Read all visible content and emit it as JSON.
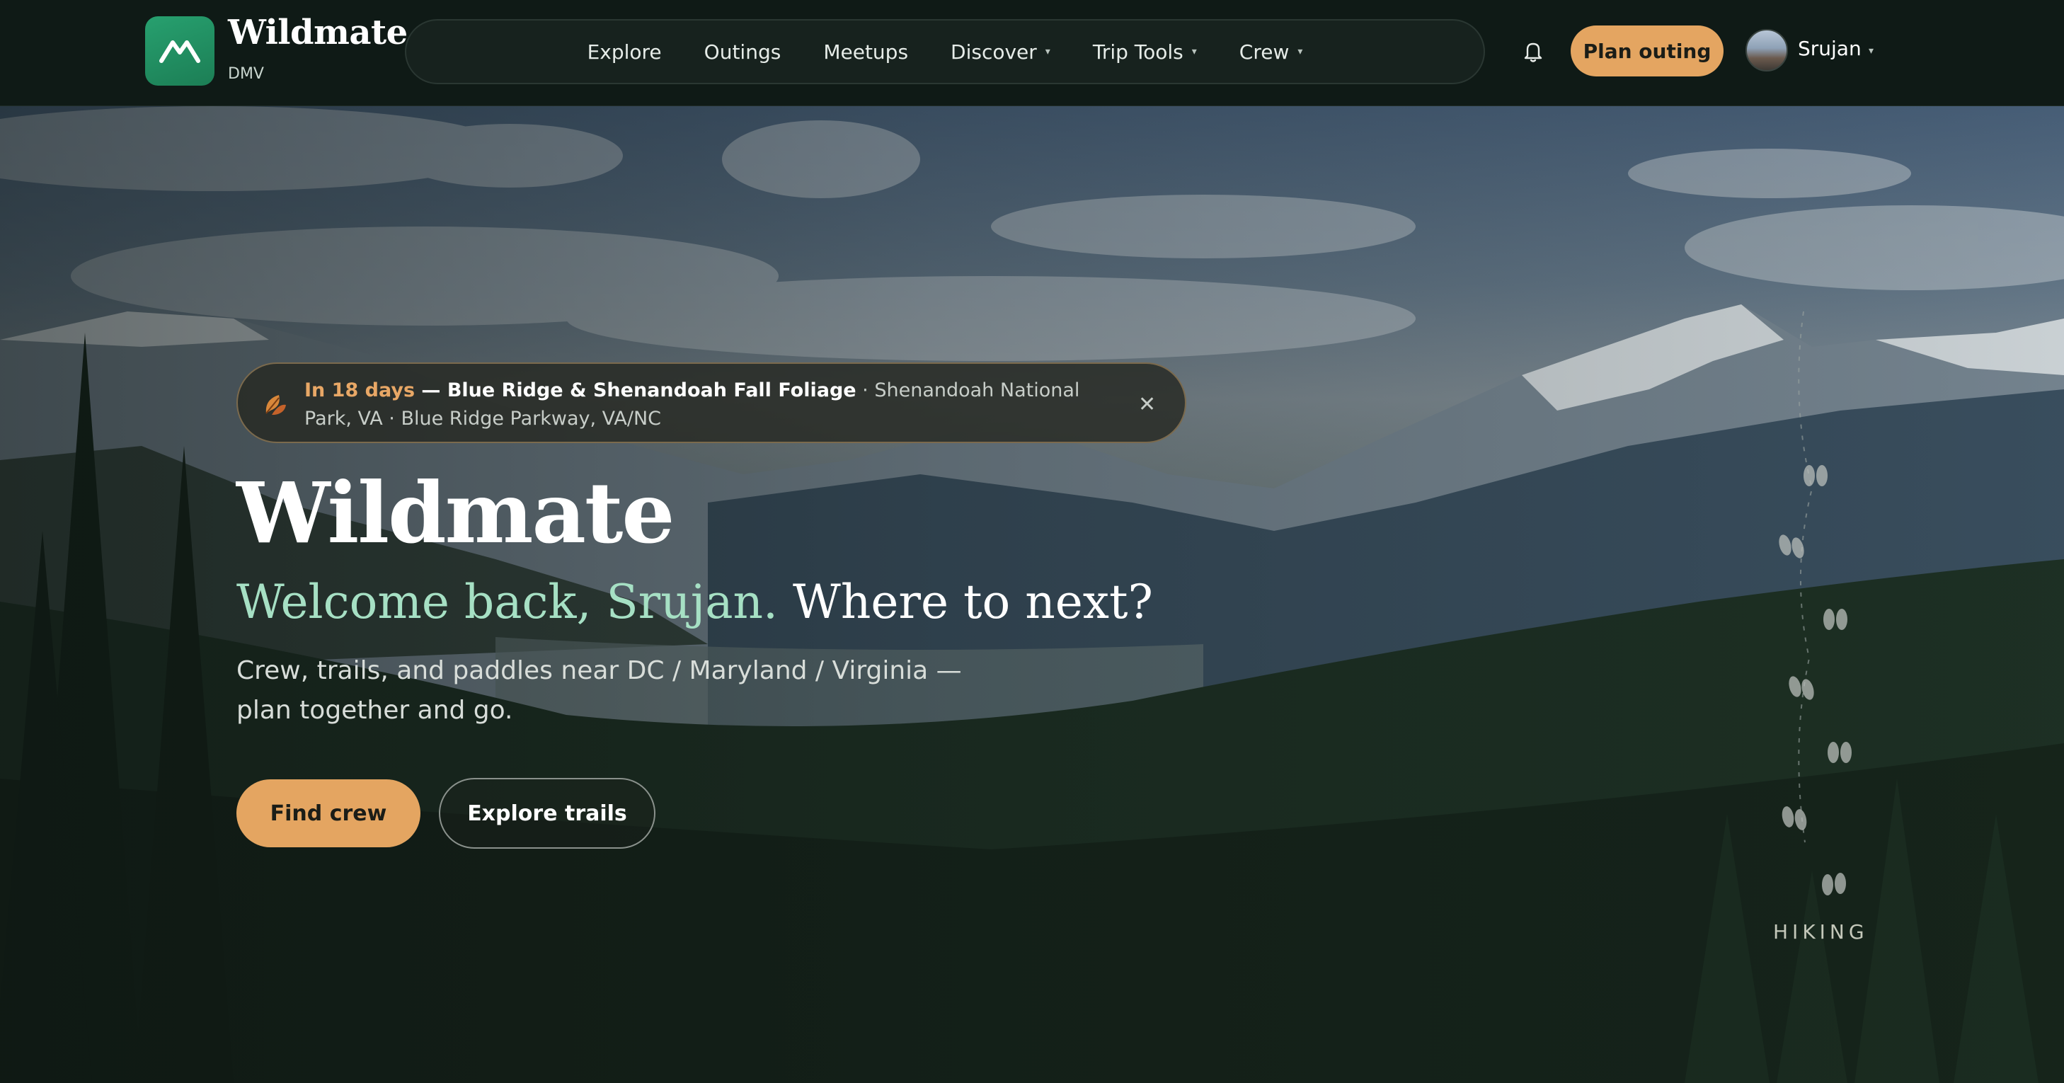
{
  "brand": {
    "name": "Wildmate",
    "region": "DMV"
  },
  "nav": {
    "items": [
      {
        "label": "Explore",
        "caret": ""
      },
      {
        "label": "Outings",
        "caret": ""
      },
      {
        "label": "Meetups",
        "caret": ""
      },
      {
        "label": "Discover",
        "caret": "▾"
      },
      {
        "label": "Trip Tools",
        "caret": "▾"
      },
      {
        "label": "Crew",
        "caret": "▾"
      }
    ]
  },
  "header": {
    "plan_label": "Plan outing",
    "user_name": "Srujan",
    "user_caret": "▾",
    "icons": {
      "notifications": "bell-icon",
      "logo": "mountain-logo-icon"
    }
  },
  "notice": {
    "days": "In 18 days",
    "separator": " — ",
    "title": "Blue Ridge & Shenandoah Fall Foliage",
    "location": " · Shenandoah National Park, VA · Blue Ridge Parkway, VA/NC",
    "close": "✕",
    "icon": "leaf-icon"
  },
  "hero": {
    "title": "Wildmate",
    "welcome": "Welcome back, Srujan.",
    "question": " Where to next?",
    "description": "Crew, trails, and paddles near DC / Maryland / Virginia — plan together and go.",
    "primary_cta": "Find crew",
    "secondary_cta": "Explore trails",
    "activity": "HIKING"
  },
  "colors": {
    "accent": "#e4a561",
    "brand_green": "#1f8a5c",
    "welcome_green": "#a6e0c4",
    "header_bg": "#0f1a16"
  }
}
